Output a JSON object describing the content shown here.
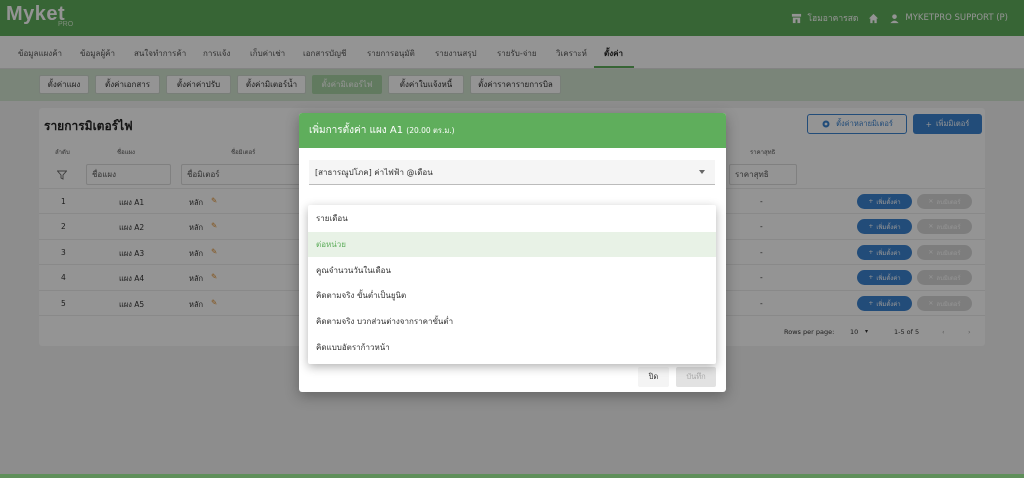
{
  "header": {
    "logo": "Myket",
    "logo_sub": "PRO",
    "building": "โฮมอาคารสด",
    "user": "MYKETPRO SUPPORT (P)"
  },
  "main_nav": [
    {
      "label": "ข้อมูลแผงค้า"
    },
    {
      "label": "ข้อมูลผู้ค้า"
    },
    {
      "label": "สนใจทำการค้า"
    },
    {
      "label": "การแจ้ง"
    },
    {
      "label": "เก็บค่าเช่า"
    },
    {
      "label": "เอกสารบัญชี"
    },
    {
      "label": "รายการอนุมัติ"
    },
    {
      "label": "รายงานสรุป"
    },
    {
      "label": "รายรับ-จ่าย"
    },
    {
      "label": "วิเคราะห์"
    },
    {
      "label": "ตั้งค่า"
    }
  ],
  "sub_nav": [
    {
      "label": "ตั้งค่าแผง"
    },
    {
      "label": "ตั้งค่าเอกสาร"
    },
    {
      "label": "ตั้งค่าค่าปรับ"
    },
    {
      "label": "ตั้งค่ามิเตอร์น้ำ"
    },
    {
      "label": "ตั้งค่ามิเตอร์ไฟ"
    },
    {
      "label": "ตั้งค่าใบแจ้งหนี้"
    },
    {
      "label": "ตั้งค่าราคารายการบิล"
    }
  ],
  "page": {
    "title": "รายการมิเตอร์ไฟ",
    "btn_multi": "ตั้งค่าหลายมิเตอร์",
    "btn_add": "เพิ่มมิเตอร์"
  },
  "table": {
    "headers": {
      "no": "ลำดับ",
      "stall": "ชื่อแผง",
      "meter": "ชื่อมิเตอร์",
      "net": "ราคาสุทธิ"
    },
    "filters": {
      "stall": "ชื่อแผง",
      "meter": "ชื่อมิเตอร์",
      "net": "ราคาสุทธิ"
    },
    "rows": [
      {
        "no": "1",
        "stall": "แผง A1",
        "meter": "หลัก",
        "net": "-"
      },
      {
        "no": "2",
        "stall": "แผง A2",
        "meter": "หลัก",
        "net": "-"
      },
      {
        "no": "3",
        "stall": "แผง A3",
        "meter": "หลัก",
        "net": "-"
      },
      {
        "no": "4",
        "stall": "แผง A4",
        "meter": "หลัก",
        "net": "-"
      },
      {
        "no": "5",
        "stall": "แผง A5",
        "meter": "หลัก",
        "net": "-"
      }
    ],
    "row_add_label": "เพิ่มตั้งค่า",
    "row_del_label": "ลบมิเตอร์",
    "pagination": {
      "rows_label": "Rows per page:",
      "rows_value": "10",
      "range": "1-5 of 5"
    }
  },
  "dialog": {
    "title": "เพิ่มการตั้งค่า แผง A1",
    "subtitle": "(20.00 ตร.ม.)",
    "select_value": "[สาธารณูปโภค] ค่าไฟฟ้า @เดือน",
    "close": "ปิด",
    "save": "บันทึก"
  },
  "dropdown": [
    {
      "label": "รายเดือน"
    },
    {
      "label": "ต่อหน่วย"
    },
    {
      "label": "คูณจำนวนวันในเดือน"
    },
    {
      "label": "คิดตามจริง ขั้นต่ำเป็นยูนิต"
    },
    {
      "label": "คิดตามจริง บวกส่วนต่างจากราคาขั้นต่ำ"
    },
    {
      "label": "คิดแบบอัตราก้าวหน้า"
    }
  ],
  "colors": {
    "brand": "#5fae5c",
    "primary": "#3b83d1"
  }
}
